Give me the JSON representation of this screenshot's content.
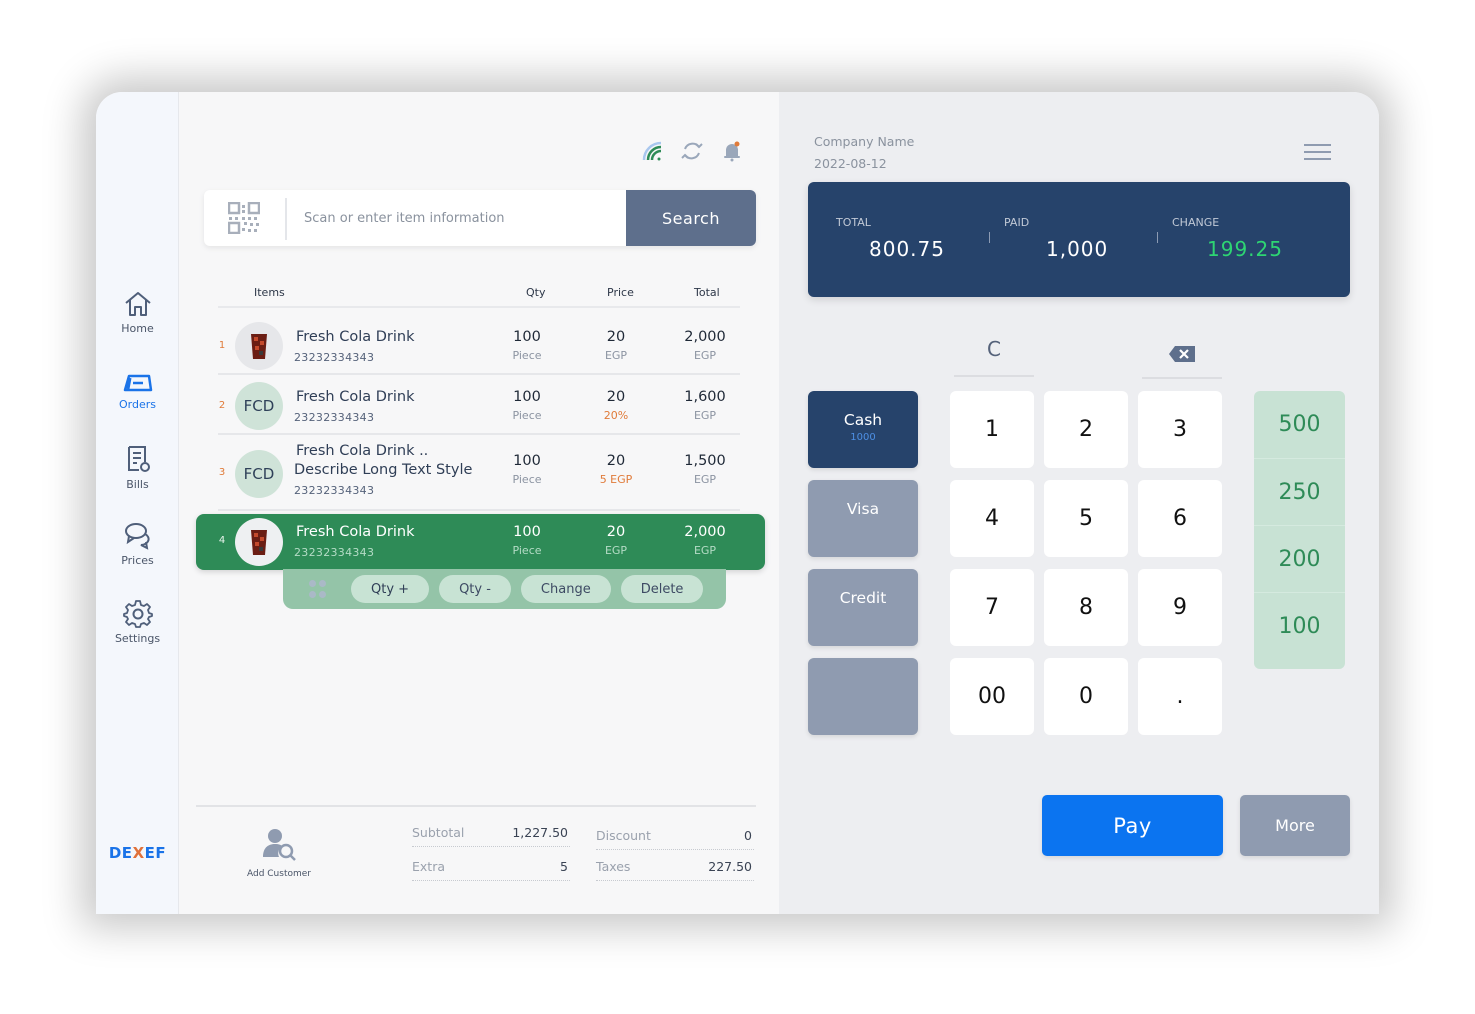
{
  "sidebar": {
    "items": [
      {
        "label": "Home",
        "icon": "home-icon",
        "active": false
      },
      {
        "label": "Orders",
        "icon": "orders-icon",
        "active": true
      },
      {
        "label": "Bills",
        "icon": "bills-icon",
        "active": false
      },
      {
        "label": "Prices",
        "icon": "chat-icon",
        "active": false
      },
      {
        "label": "Settings",
        "icon": "gear-icon",
        "active": false
      }
    ],
    "logo": {
      "part1": "DE",
      "part2": "X",
      "part3": "EF"
    }
  },
  "topbar": {
    "icons": [
      "wifi-icon",
      "refresh-icon",
      "bell-icon"
    ]
  },
  "search": {
    "placeholder": "Scan or enter item information",
    "value": "",
    "button_label": "Search"
  },
  "table": {
    "headers": {
      "items": "Items",
      "qty": "Qty",
      "price": "Price",
      "total": "Total"
    },
    "rows": [
      {
        "num": "1",
        "avatar": "image",
        "avatar_text": "",
        "name": "Fresh Cola Drink",
        "name2": "",
        "code": "23232334343",
        "qty": "100",
        "qty_unit": "Piece",
        "price": "20",
        "price_unit": "EGP",
        "price_unit_highlight": false,
        "total": "2,000",
        "total_unit": "EGP",
        "selected": false
      },
      {
        "num": "2",
        "avatar": "initials",
        "avatar_text": "FCD",
        "name": "Fresh Cola Drink",
        "name2": "",
        "code": "23232334343",
        "qty": "100",
        "qty_unit": "Piece",
        "price": "20",
        "price_unit": "20%",
        "price_unit_highlight": true,
        "total": "1,600",
        "total_unit": "EGP",
        "selected": false
      },
      {
        "num": "3",
        "avatar": "initials",
        "avatar_text": "FCD",
        "name": "Fresh Cola Drink ..",
        "name2": "Describe Long Text Style",
        "code": "23232334343",
        "qty": "100",
        "qty_unit": "Piece",
        "price": "20",
        "price_unit": "5 EGP",
        "price_unit_highlight": true,
        "total": "1,500",
        "total_unit": "EGP",
        "selected": false
      },
      {
        "num": "4",
        "avatar": "image",
        "avatar_text": "",
        "name": "Fresh Cola Drink",
        "name2": "",
        "code": "23232334343",
        "qty": "100",
        "qty_unit": "Piece",
        "price": "20",
        "price_unit": "EGP",
        "price_unit_highlight": false,
        "total": "2,000",
        "total_unit": "EGP",
        "selected": true
      }
    ]
  },
  "row_actions": {
    "qty_plus": "Qty +",
    "qty_minus": "Qty -",
    "change": "Change",
    "delete": "Delete"
  },
  "footer": {
    "add_customer": "Add Customer",
    "subtotal_label": "Subtotal",
    "subtotal": "1,227.50",
    "extra_label": "Extra",
    "extra": "5",
    "discount_label": "Discount",
    "discount": "0",
    "taxes_label": "Taxes",
    "taxes": "227.50"
  },
  "header_right": {
    "company": "Company Name",
    "date": "2022-08-12"
  },
  "summary": {
    "total_label": "TOTAL",
    "total": "800.75",
    "paid_label": "PAID",
    "paid": "1,000",
    "change_label": "CHANGE",
    "change": "199.25",
    "change_color": "#2ed573"
  },
  "keypad": {
    "clear": "C",
    "keys": [
      "1",
      "2",
      "3",
      "4",
      "5",
      "6",
      "7",
      "8",
      "9",
      "00",
      "0",
      "."
    ]
  },
  "payment_methods": [
    {
      "label": "Cash",
      "sub": "1000",
      "active": true
    },
    {
      "label": "Visa",
      "sub": "",
      "active": false
    },
    {
      "label": "Credit",
      "sub": "",
      "active": false
    },
    {
      "label": "",
      "sub": "",
      "active": false
    }
  ],
  "quick_cash": [
    "500",
    "250",
    "200",
    "100"
  ],
  "actions": {
    "pay": "Pay",
    "more": "More"
  },
  "colors": {
    "primary": "#0b74f0",
    "navy": "#26436b",
    "selected_row": "#2e8b57",
    "accent_orange": "#e07b3a"
  }
}
